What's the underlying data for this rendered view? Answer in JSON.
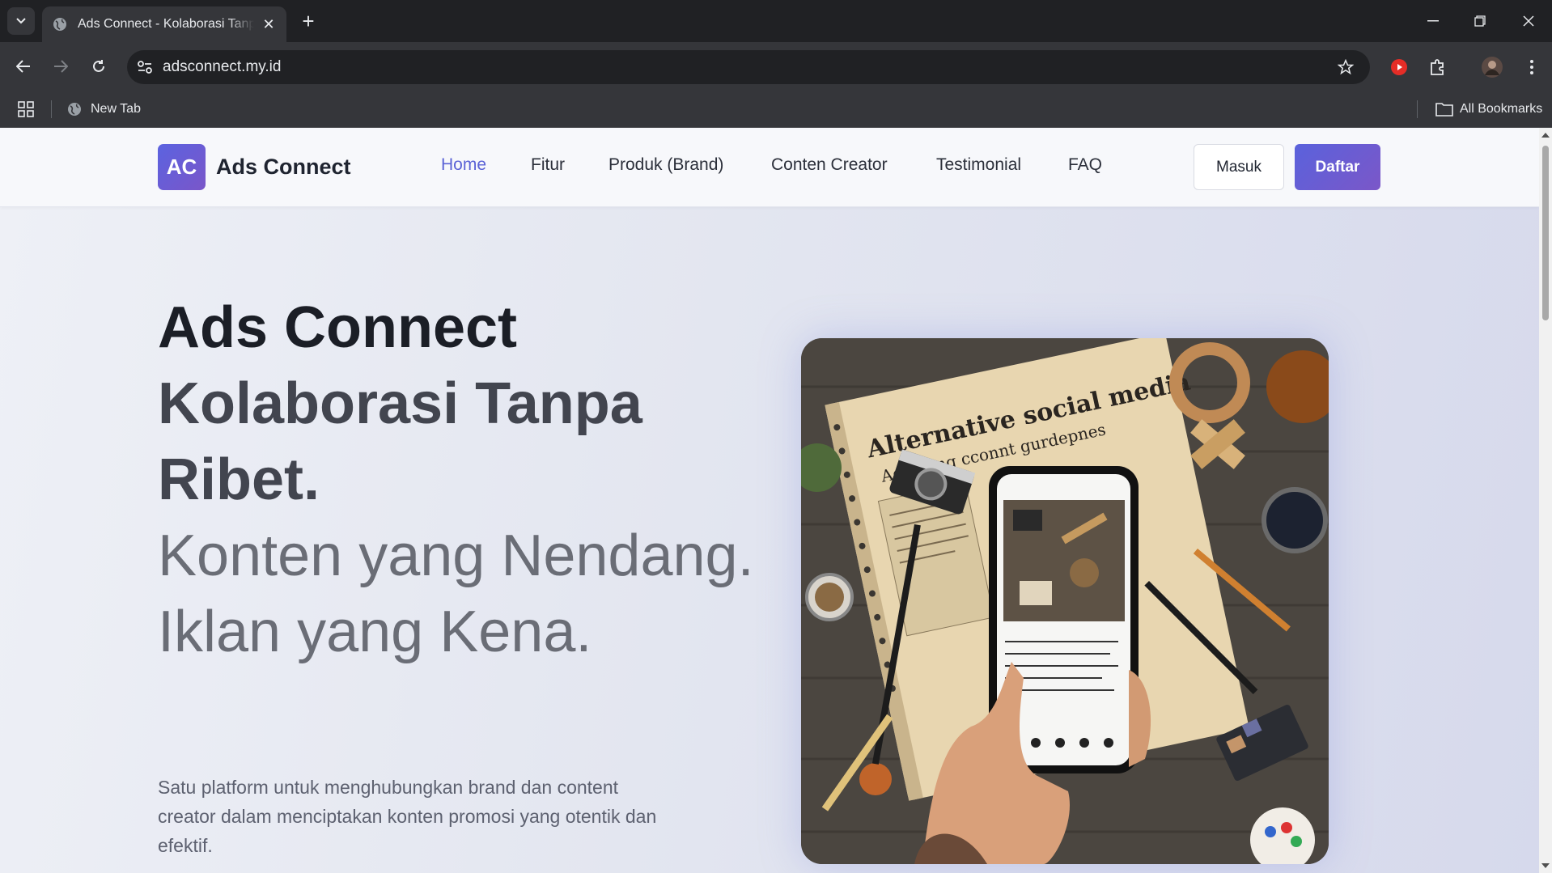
{
  "browser": {
    "tab_title": "Ads Connect - Kolaborasi Tanpa Ribet.",
    "url": "adsconnect.my.id",
    "bookmarks": {
      "new_tab": "New Tab",
      "all_bookmarks": "All Bookmarks"
    }
  },
  "nav": {
    "logo_mark": "AC",
    "logo_text": "Ads Connect",
    "links": [
      "Home",
      "Fitur",
      "Produk (Brand)",
      "Conten Creator",
      "Testimonial",
      "FAQ"
    ],
    "active_link": "Home",
    "login": "Masuk",
    "register": "Daftar"
  },
  "hero": {
    "title_line1": "Ads Connect",
    "title_line2": "Kolaborasi Tanpa Ribet.",
    "subtitle": "Konten yang Nendang. Iklan yang Kena.",
    "description": "Satu platform untuk menghubungkan brand dan content creator dalam menciptakan konten promosi yang otentik dan efektif.",
    "image_caption": "Alternative social media",
    "image_caption_sub": "Adddring cconnt gurdepnes"
  },
  "colors": {
    "accent": "#5b63d6",
    "brand_gradient_start": "#5a62dc",
    "brand_gradient_end": "#7b57c8"
  }
}
